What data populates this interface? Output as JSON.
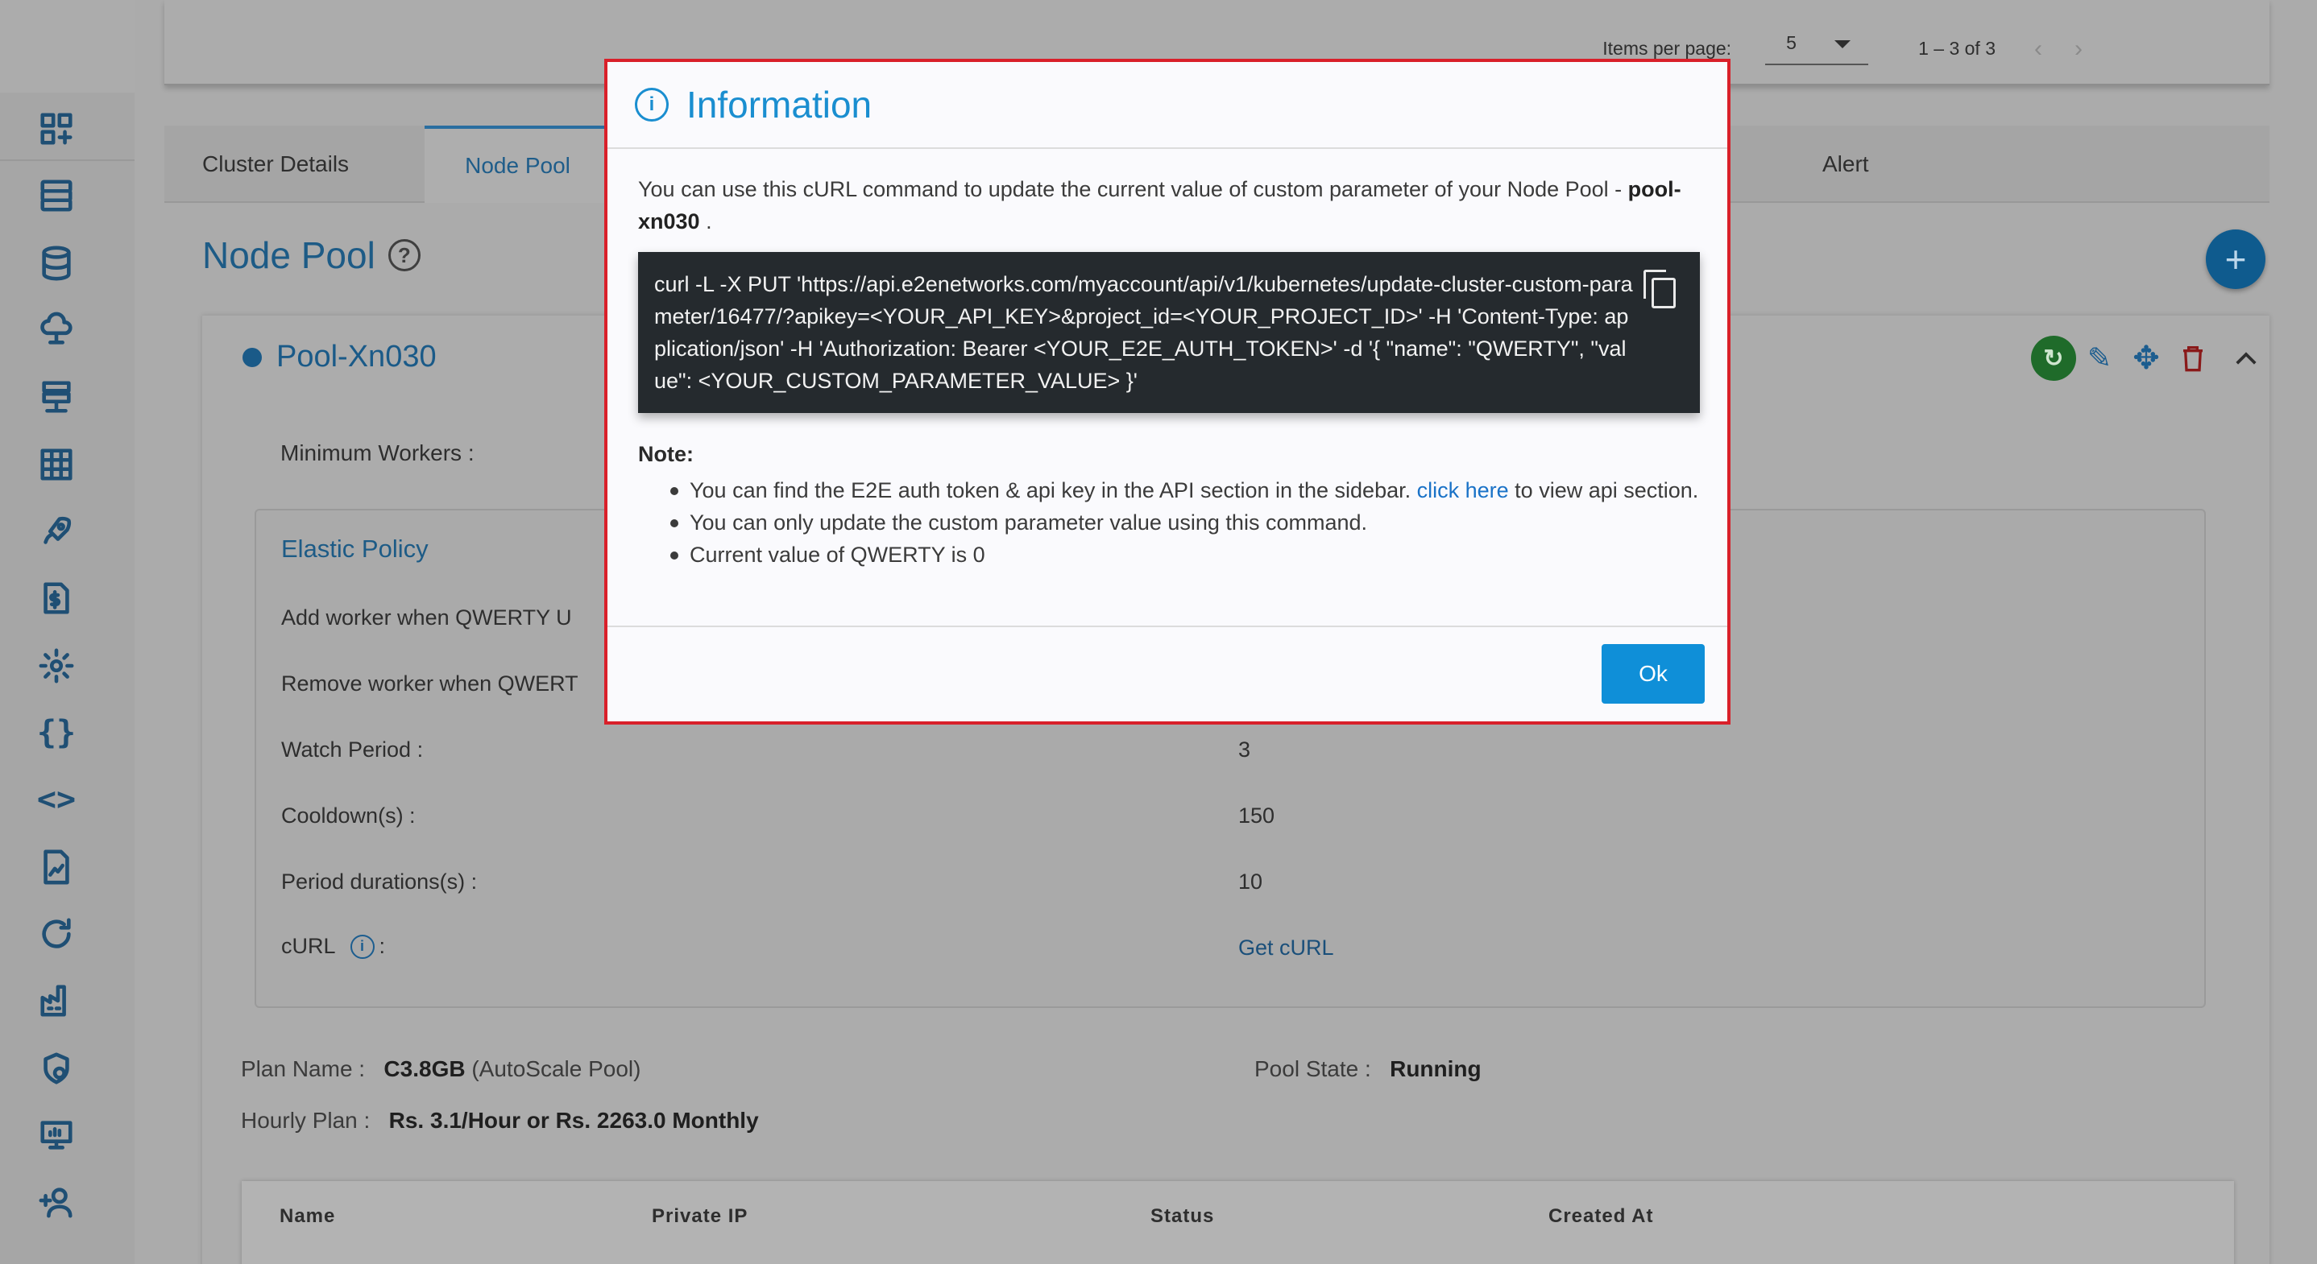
{
  "sidebar": {
    "icons": [
      "dashboard-add-icon",
      "server-icon",
      "database-icon",
      "cloud-icon",
      "network-icon",
      "grid-icon",
      "rocket-icon",
      "billing-icon",
      "settings-icon",
      "braces-icon",
      "code-icon",
      "file-chart-icon",
      "refresh-bubble-icon",
      "factory-icon",
      "security-icon",
      "monitor-icon",
      "add-user-icon"
    ],
    "glyph_braces": "{}",
    "glyph_code": "<>"
  },
  "pager": {
    "items_per_page_label": "Items per page:",
    "items_per_page_value": "5",
    "range": "1 – 3 of 3",
    "prev": "‹",
    "next": "›"
  },
  "tabs": {
    "cluster_details": "Cluster Details",
    "node_pool": "Node Pool",
    "alert": "Alert"
  },
  "page": {
    "title": "Node Pool",
    "help": "?",
    "add": "+"
  },
  "pool": {
    "name": "Pool-Xn030",
    "min_workers_label": "Minimum Workers :",
    "elastic_title": "Elastic Policy",
    "add_worker_label": "Add worker when QWERTY U",
    "remove_worker_label": "Remove worker when QWERT",
    "watch_period_label": "Watch Period :",
    "watch_period_value": "3",
    "cooldown_label": "Cooldown(s) :",
    "cooldown_value": "150",
    "period_durations_label": "Period durations(s) :",
    "period_durations_value": "10",
    "curl_label": "cURL",
    "curl_colon": ":",
    "get_curl": "Get cURL",
    "plan_name_label": "Plan Name :",
    "plan_name_value": "C3.8GB",
    "plan_name_suffix": "(AutoScale Pool)",
    "pool_state_label": "Pool State :",
    "pool_state_value": "Running",
    "hourly_plan_label": "Hourly Plan :",
    "hourly_plan_value": "Rs. 3.1/Hour or Rs. 2263.0 Monthly"
  },
  "table": {
    "headers": [
      "Name",
      "Private IP",
      "Status",
      "Created At"
    ]
  },
  "modal": {
    "title": "Information",
    "desc_prefix": "You can use this cURL command to update the current value of custom parameter of your Node Pool - ",
    "desc_pool": "pool-xn030",
    "desc_suffix": " .",
    "curl_command": "curl -L -X PUT 'https://api.e2enetworks.com/myaccount/api/v1/kubernetes/update-cluster-custom-parameter/16477/?apikey=<YOUR_API_KEY>&project_id=<YOUR_PROJECT_ID>' -H 'Content-Type: application/json' -H 'Authorization: Bearer <YOUR_E2E_AUTH_TOKEN>' -d '{ \"name\": \"QWERTY\", \"value\": <YOUR_CUSTOM_PARAMETER_VALUE> }'",
    "note_label": "Note:",
    "note1_prefix": "You can find the E2E auth token & api key in the API section in the sidebar. ",
    "note1_link": "click here",
    "note1_suffix": " to view api section.",
    "note2": "You can only update the custom parameter value using this command.",
    "note3": "Current value of QWERTY is 0",
    "ok": "Ok"
  },
  "colors": {
    "accent": "#1a8ed0",
    "modal_border": "#d9202a",
    "code_bg": "#252a2e",
    "ok_button": "#0f8fd8"
  }
}
